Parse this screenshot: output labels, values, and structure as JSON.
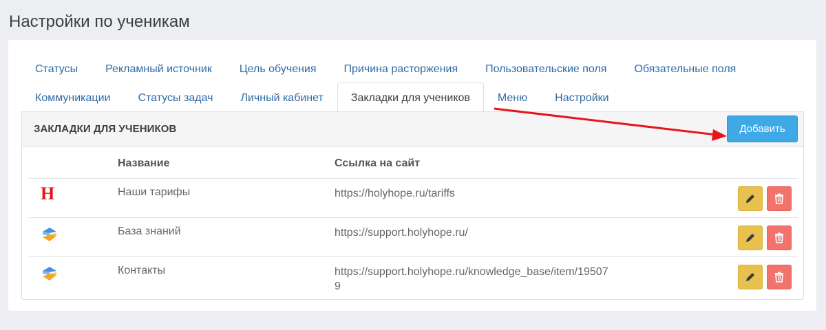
{
  "page": {
    "title": "Настройки по ученикам"
  },
  "tabs": {
    "row1": [
      {
        "label": "Статусы"
      },
      {
        "label": "Рекламный источник"
      },
      {
        "label": "Цель обучения"
      },
      {
        "label": "Причина расторжения"
      },
      {
        "label": "Пользовательские поля"
      },
      {
        "label": "Обязательные поля"
      }
    ],
    "row2": [
      {
        "label": "Коммуникации"
      },
      {
        "label": "Статусы задач"
      },
      {
        "label": "Личный кабинет"
      },
      {
        "label": "Закладки для учеников",
        "active": true
      },
      {
        "label": "Меню"
      },
      {
        "label": "Настройки"
      }
    ]
  },
  "panel": {
    "title": "Закладки для учеников",
    "add_button": "Добавить"
  },
  "table": {
    "columns": [
      "",
      "Название",
      "Ссылка на сайт",
      ""
    ],
    "rows": [
      {
        "icon": "holyhope-h-logo",
        "logo_text": "H",
        "name": "Наши тарифы",
        "url": "https://holyhope.ru/tariffs"
      },
      {
        "icon": "support-knowledge-icon",
        "name": "База знаний",
        "url": "https://support.holyhope.ru/"
      },
      {
        "icon": "support-knowledge-icon",
        "name": "Контакты",
        "url": "https://support.holyhope.ru/knowledge_base/item/195079"
      }
    ]
  },
  "colors": {
    "accent": "#3fa9e8",
    "link": "#2f6aa6",
    "edit": "#e8c14f",
    "delete": "#f2736b",
    "annotation": "#e8141b"
  },
  "icons": {
    "edit": "pencil-icon",
    "delete": "trash-icon",
    "annotation": "red-arrow"
  }
}
